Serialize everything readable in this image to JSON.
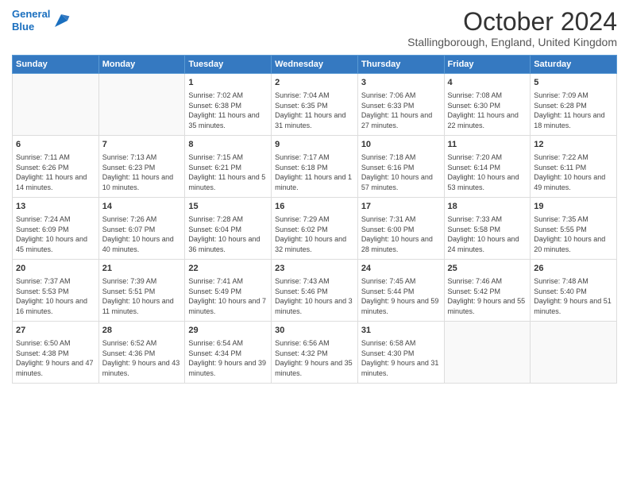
{
  "logo": {
    "line1": "General",
    "line2": "Blue"
  },
  "header": {
    "month": "October 2024",
    "location": "Stallingborough, England, United Kingdom"
  },
  "weekdays": [
    "Sunday",
    "Monday",
    "Tuesday",
    "Wednesday",
    "Thursday",
    "Friday",
    "Saturday"
  ],
  "weeks": [
    [
      {
        "day": "",
        "sunrise": "",
        "sunset": "",
        "daylight": ""
      },
      {
        "day": "",
        "sunrise": "",
        "sunset": "",
        "daylight": ""
      },
      {
        "day": "1",
        "sunrise": "Sunrise: 7:02 AM",
        "sunset": "Sunset: 6:38 PM",
        "daylight": "Daylight: 11 hours and 35 minutes."
      },
      {
        "day": "2",
        "sunrise": "Sunrise: 7:04 AM",
        "sunset": "Sunset: 6:35 PM",
        "daylight": "Daylight: 11 hours and 31 minutes."
      },
      {
        "day": "3",
        "sunrise": "Sunrise: 7:06 AM",
        "sunset": "Sunset: 6:33 PM",
        "daylight": "Daylight: 11 hours and 27 minutes."
      },
      {
        "day": "4",
        "sunrise": "Sunrise: 7:08 AM",
        "sunset": "Sunset: 6:30 PM",
        "daylight": "Daylight: 11 hours and 22 minutes."
      },
      {
        "day": "5",
        "sunrise": "Sunrise: 7:09 AM",
        "sunset": "Sunset: 6:28 PM",
        "daylight": "Daylight: 11 hours and 18 minutes."
      }
    ],
    [
      {
        "day": "6",
        "sunrise": "Sunrise: 7:11 AM",
        "sunset": "Sunset: 6:26 PM",
        "daylight": "Daylight: 11 hours and 14 minutes."
      },
      {
        "day": "7",
        "sunrise": "Sunrise: 7:13 AM",
        "sunset": "Sunset: 6:23 PM",
        "daylight": "Daylight: 11 hours and 10 minutes."
      },
      {
        "day": "8",
        "sunrise": "Sunrise: 7:15 AM",
        "sunset": "Sunset: 6:21 PM",
        "daylight": "Daylight: 11 hours and 5 minutes."
      },
      {
        "day": "9",
        "sunrise": "Sunrise: 7:17 AM",
        "sunset": "Sunset: 6:18 PM",
        "daylight": "Daylight: 11 hours and 1 minute."
      },
      {
        "day": "10",
        "sunrise": "Sunrise: 7:18 AM",
        "sunset": "Sunset: 6:16 PM",
        "daylight": "Daylight: 10 hours and 57 minutes."
      },
      {
        "day": "11",
        "sunrise": "Sunrise: 7:20 AM",
        "sunset": "Sunset: 6:14 PM",
        "daylight": "Daylight: 10 hours and 53 minutes."
      },
      {
        "day": "12",
        "sunrise": "Sunrise: 7:22 AM",
        "sunset": "Sunset: 6:11 PM",
        "daylight": "Daylight: 10 hours and 49 minutes."
      }
    ],
    [
      {
        "day": "13",
        "sunrise": "Sunrise: 7:24 AM",
        "sunset": "Sunset: 6:09 PM",
        "daylight": "Daylight: 10 hours and 45 minutes."
      },
      {
        "day": "14",
        "sunrise": "Sunrise: 7:26 AM",
        "sunset": "Sunset: 6:07 PM",
        "daylight": "Daylight: 10 hours and 40 minutes."
      },
      {
        "day": "15",
        "sunrise": "Sunrise: 7:28 AM",
        "sunset": "Sunset: 6:04 PM",
        "daylight": "Daylight: 10 hours and 36 minutes."
      },
      {
        "day": "16",
        "sunrise": "Sunrise: 7:29 AM",
        "sunset": "Sunset: 6:02 PM",
        "daylight": "Daylight: 10 hours and 32 minutes."
      },
      {
        "day": "17",
        "sunrise": "Sunrise: 7:31 AM",
        "sunset": "Sunset: 6:00 PM",
        "daylight": "Daylight: 10 hours and 28 minutes."
      },
      {
        "day": "18",
        "sunrise": "Sunrise: 7:33 AM",
        "sunset": "Sunset: 5:58 PM",
        "daylight": "Daylight: 10 hours and 24 minutes."
      },
      {
        "day": "19",
        "sunrise": "Sunrise: 7:35 AM",
        "sunset": "Sunset: 5:55 PM",
        "daylight": "Daylight: 10 hours and 20 minutes."
      }
    ],
    [
      {
        "day": "20",
        "sunrise": "Sunrise: 7:37 AM",
        "sunset": "Sunset: 5:53 PM",
        "daylight": "Daylight: 10 hours and 16 minutes."
      },
      {
        "day": "21",
        "sunrise": "Sunrise: 7:39 AM",
        "sunset": "Sunset: 5:51 PM",
        "daylight": "Daylight: 10 hours and 11 minutes."
      },
      {
        "day": "22",
        "sunrise": "Sunrise: 7:41 AM",
        "sunset": "Sunset: 5:49 PM",
        "daylight": "Daylight: 10 hours and 7 minutes."
      },
      {
        "day": "23",
        "sunrise": "Sunrise: 7:43 AM",
        "sunset": "Sunset: 5:46 PM",
        "daylight": "Daylight: 10 hours and 3 minutes."
      },
      {
        "day": "24",
        "sunrise": "Sunrise: 7:45 AM",
        "sunset": "Sunset: 5:44 PM",
        "daylight": "Daylight: 9 hours and 59 minutes."
      },
      {
        "day": "25",
        "sunrise": "Sunrise: 7:46 AM",
        "sunset": "Sunset: 5:42 PM",
        "daylight": "Daylight: 9 hours and 55 minutes."
      },
      {
        "day": "26",
        "sunrise": "Sunrise: 7:48 AM",
        "sunset": "Sunset: 5:40 PM",
        "daylight": "Daylight: 9 hours and 51 minutes."
      }
    ],
    [
      {
        "day": "27",
        "sunrise": "Sunrise: 6:50 AM",
        "sunset": "Sunset: 4:38 PM",
        "daylight": "Daylight: 9 hours and 47 minutes."
      },
      {
        "day": "28",
        "sunrise": "Sunrise: 6:52 AM",
        "sunset": "Sunset: 4:36 PM",
        "daylight": "Daylight: 9 hours and 43 minutes."
      },
      {
        "day": "29",
        "sunrise": "Sunrise: 6:54 AM",
        "sunset": "Sunset: 4:34 PM",
        "daylight": "Daylight: 9 hours and 39 minutes."
      },
      {
        "day": "30",
        "sunrise": "Sunrise: 6:56 AM",
        "sunset": "Sunset: 4:32 PM",
        "daylight": "Daylight: 9 hours and 35 minutes."
      },
      {
        "day": "31",
        "sunrise": "Sunrise: 6:58 AM",
        "sunset": "Sunset: 4:30 PM",
        "daylight": "Daylight: 9 hours and 31 minutes."
      },
      {
        "day": "",
        "sunrise": "",
        "sunset": "",
        "daylight": ""
      },
      {
        "day": "",
        "sunrise": "",
        "sunset": "",
        "daylight": ""
      }
    ]
  ]
}
